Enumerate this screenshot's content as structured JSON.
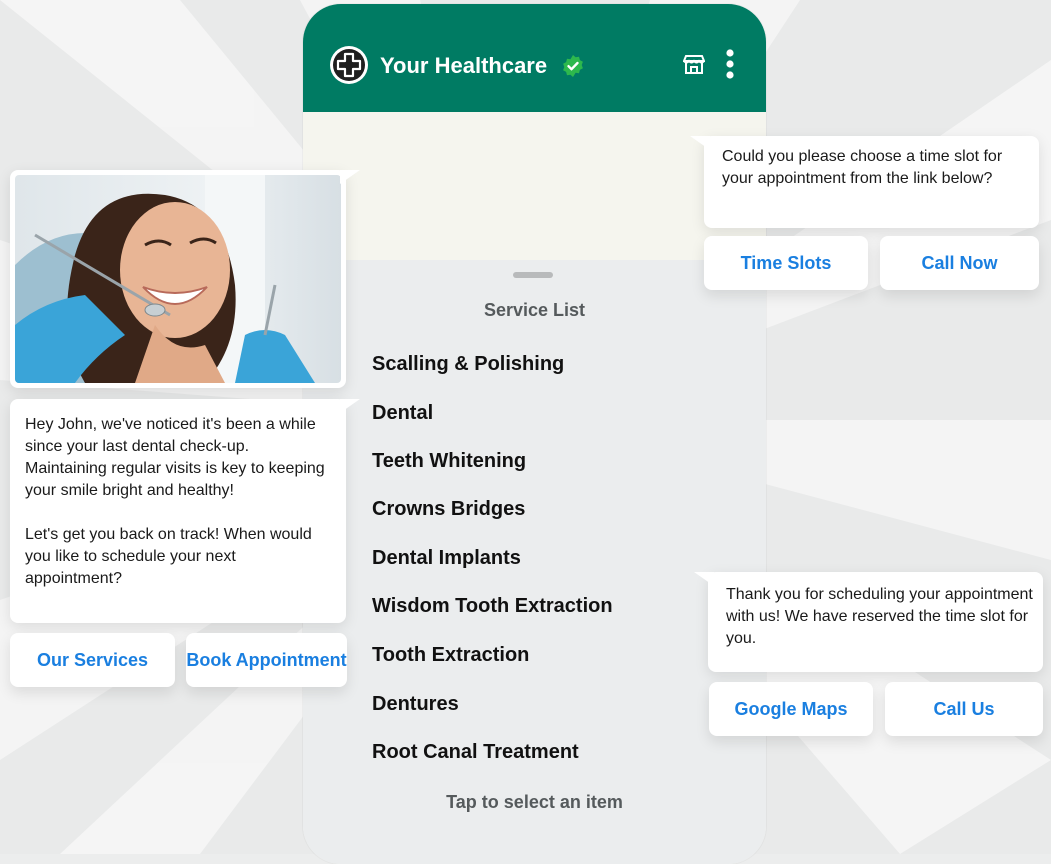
{
  "header": {
    "brand_name": "Your Healthcare",
    "logo_icon": "medical-cross-icon",
    "verified_icon": "verified-check-icon",
    "store_icon": "store-icon",
    "menu_icon": "more-vertical-icon",
    "color": "#007b63"
  },
  "service_sheet": {
    "title": "Service List",
    "items": [
      "Scalling & Polishing",
      "Dental",
      "Teeth Whitening",
      "Crowns Bridges",
      "Dental Implants",
      "Wisdom Tooth Extraction",
      "Tooth Extraction",
      "Dentures",
      "Root Canal Treatment"
    ],
    "footer": "Tap to select an item"
  },
  "left_message": {
    "text": "Hey John,  we've noticed it's been a while since your last dental check-up. Maintaining regular visits is key to keeping your smile bright and healthy!\n\nLet's get you back on track! When would you like to schedule your next appointment?",
    "buttons": [
      "Our Services",
      "Book Appointment"
    ]
  },
  "top_right_message": {
    "text": "Could you please choose a time slot for your appointment from the link below?",
    "buttons": [
      "Time Slots",
      "Call Now"
    ]
  },
  "bottom_right_message": {
    "text": "Thank you for scheduling your appointment with us! We have reserved the time slot for you.",
    "buttons": [
      "Google Maps",
      "Call Us"
    ]
  },
  "colors": {
    "accent_link": "#1a7fe0",
    "verified": "#2db84d"
  }
}
